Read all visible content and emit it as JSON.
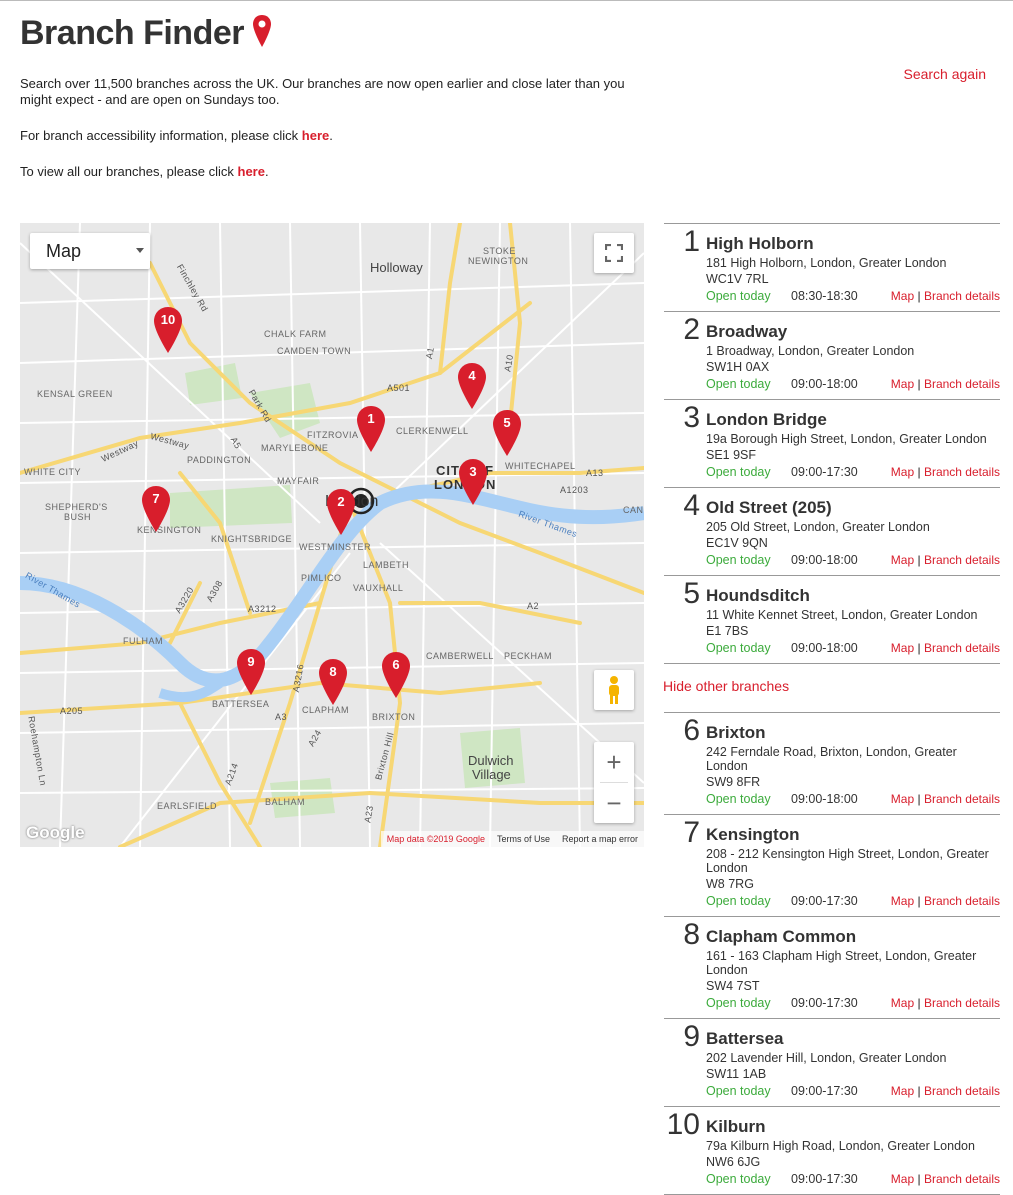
{
  "page": {
    "title": "Branch Finder",
    "intro": "Search over 11,500 branches across the UK. Our branches are now open earlier and close later than you might expect - and are open on Sundays too.",
    "accessibility_prefix": "For branch accessibility information, please click ",
    "accessibility_link": "here",
    "view_all_prefix": "To view all our branches, please click ",
    "view_all_link": "here",
    "period": ".",
    "search_again": "Search again"
  },
  "map": {
    "type_select": "Map",
    "google_logo": "Google",
    "map_data": "Map data ©2019 Google",
    "terms": "Terms of Use",
    "report": "Report a map error",
    "zoom_in": "+",
    "zoom_out": "−",
    "labels": {
      "holloway": "Holloway",
      "stoke": "STOKE",
      "newington": "NEWINGTON",
      "chalk_farm": "CHALK FARM",
      "camden": "CAMDEN TOWN",
      "kensal": "KENSAL GREEN",
      "clerkenwell": "CLERKENWELL",
      "fitzrovia": "FITZROVIA",
      "marylebone": "MARYLEBONE",
      "paddington": "PADDINGTON",
      "white_city": "WHITE CITY",
      "shepherds": "SHEPHERD'S",
      "bush": "BUSH",
      "kensington": "KENSINGTON",
      "knightsbridge": "KNIGHTSBRIDGE",
      "mayfair": "MAYFAIR",
      "westminster": "WESTMINSTER",
      "lambeth": "LAMBETH",
      "pimlico": "PIMLICO",
      "vauxhall": "VAUXHALL",
      "city": "CITY OF",
      "london_city": "LONDON",
      "london": "London",
      "whitechapel": "WHITECHAPEL",
      "fulham": "FULHAM",
      "battersea": "BATTERSEA",
      "clapham": "CLAPHAM",
      "brixton": "BRIXTON",
      "camberwell": "CAMBERWELL",
      "peckham": "PECKHAM",
      "dulwich": "Dulwich",
      "village": "Village",
      "earlsfield": "EARLSFIELD",
      "balham": "BALHAM",
      "river_thames": "River Thames",
      "river_thames2": "River Thames",
      "finchley": "Finchley Rd",
      "westway": "Westway",
      "westway2": "Westway",
      "a501": "A501",
      "a10": "A10",
      "a1": "A1",
      "a13": "A13",
      "a1203": "A1203",
      "a2": "A2",
      "a3": "A3",
      "a205": "A205",
      "a24": "A24",
      "a23": "A23",
      "a214": "A214",
      "a3220": "A3220",
      "a308": "A308",
      "a3212": "A3212",
      "a3216": "A3216",
      "a5": "A5",
      "park_rd": "Park Rd",
      "brixton_hill": "Brixton Hill",
      "roehampton": "Roehampton Ln",
      "can": "CAN"
    },
    "markers": [
      "1",
      "2",
      "3",
      "4",
      "5",
      "6",
      "7",
      "8",
      "9",
      "10"
    ]
  },
  "branches": [
    {
      "num": "1",
      "name": "High Holborn",
      "addr": "181 High Holborn, London, Greater London",
      "post": "WC1V 7RL",
      "open": "Open today",
      "hours": "08:30-18:30",
      "map": "Map",
      "details": "Branch details"
    },
    {
      "num": "2",
      "name": "Broadway",
      "addr": "1 Broadway, London, Greater London",
      "post": "SW1H 0AX",
      "open": "Open today",
      "hours": "09:00-18:00",
      "map": "Map",
      "details": "Branch details"
    },
    {
      "num": "3",
      "name": "London Bridge",
      "addr": "19a Borough High Street, London, Greater London",
      "post": "SE1 9SF",
      "open": "Open today",
      "hours": "09:00-17:30",
      "map": "Map",
      "details": "Branch details"
    },
    {
      "num": "4",
      "name": "Old Street (205)",
      "addr": "205 Old Street, London, Greater London",
      "post": "EC1V 9QN",
      "open": "Open today",
      "hours": "09:00-18:00",
      "map": "Map",
      "details": "Branch details"
    },
    {
      "num": "5",
      "name": "Houndsditch",
      "addr": "11 White Kennet Street, London, Greater London",
      "post": "E1 7BS",
      "open": "Open today",
      "hours": "09:00-18:00",
      "map": "Map",
      "details": "Branch details"
    },
    {
      "num": "6",
      "name": "Brixton",
      "addr": "242 Ferndale Road, Brixton, London, Greater London",
      "post": "SW9 8FR",
      "open": "Open today",
      "hours": "09:00-18:00",
      "map": "Map",
      "details": "Branch details"
    },
    {
      "num": "7",
      "name": "Kensington",
      "addr": "208 - 212 Kensington High Street, London, Greater London",
      "post": "W8 7RG",
      "open": "Open today",
      "hours": "09:00-17:30",
      "map": "Map",
      "details": "Branch details"
    },
    {
      "num": "8",
      "name": "Clapham Common",
      "addr": "161 - 163 Clapham High Street, London, Greater London",
      "post": "SW4 7ST",
      "open": "Open today",
      "hours": "09:00-17:30",
      "map": "Map",
      "details": "Branch details"
    },
    {
      "num": "9",
      "name": "Battersea",
      "addr": "202 Lavender Hill, London, Greater London",
      "post": "SW11 1AB",
      "open": "Open today",
      "hours": "09:00-17:30",
      "map": "Map",
      "details": "Branch details"
    },
    {
      "num": "10",
      "name": "Kilburn",
      "addr": "79a Kilburn High Road, London, Greater London",
      "post": "NW6 6JG",
      "open": "Open today",
      "hours": "09:00-17:30",
      "map": "Map",
      "details": "Branch details"
    }
  ],
  "hide_other": "Hide other branches",
  "pipe": "|",
  "colors": {
    "brand_red": "#d81e2c",
    "open_green": "#3cab3c",
    "map_bg": "#e8e8e8",
    "water": "#a9cff5",
    "road_yellow": "#f7d774"
  }
}
